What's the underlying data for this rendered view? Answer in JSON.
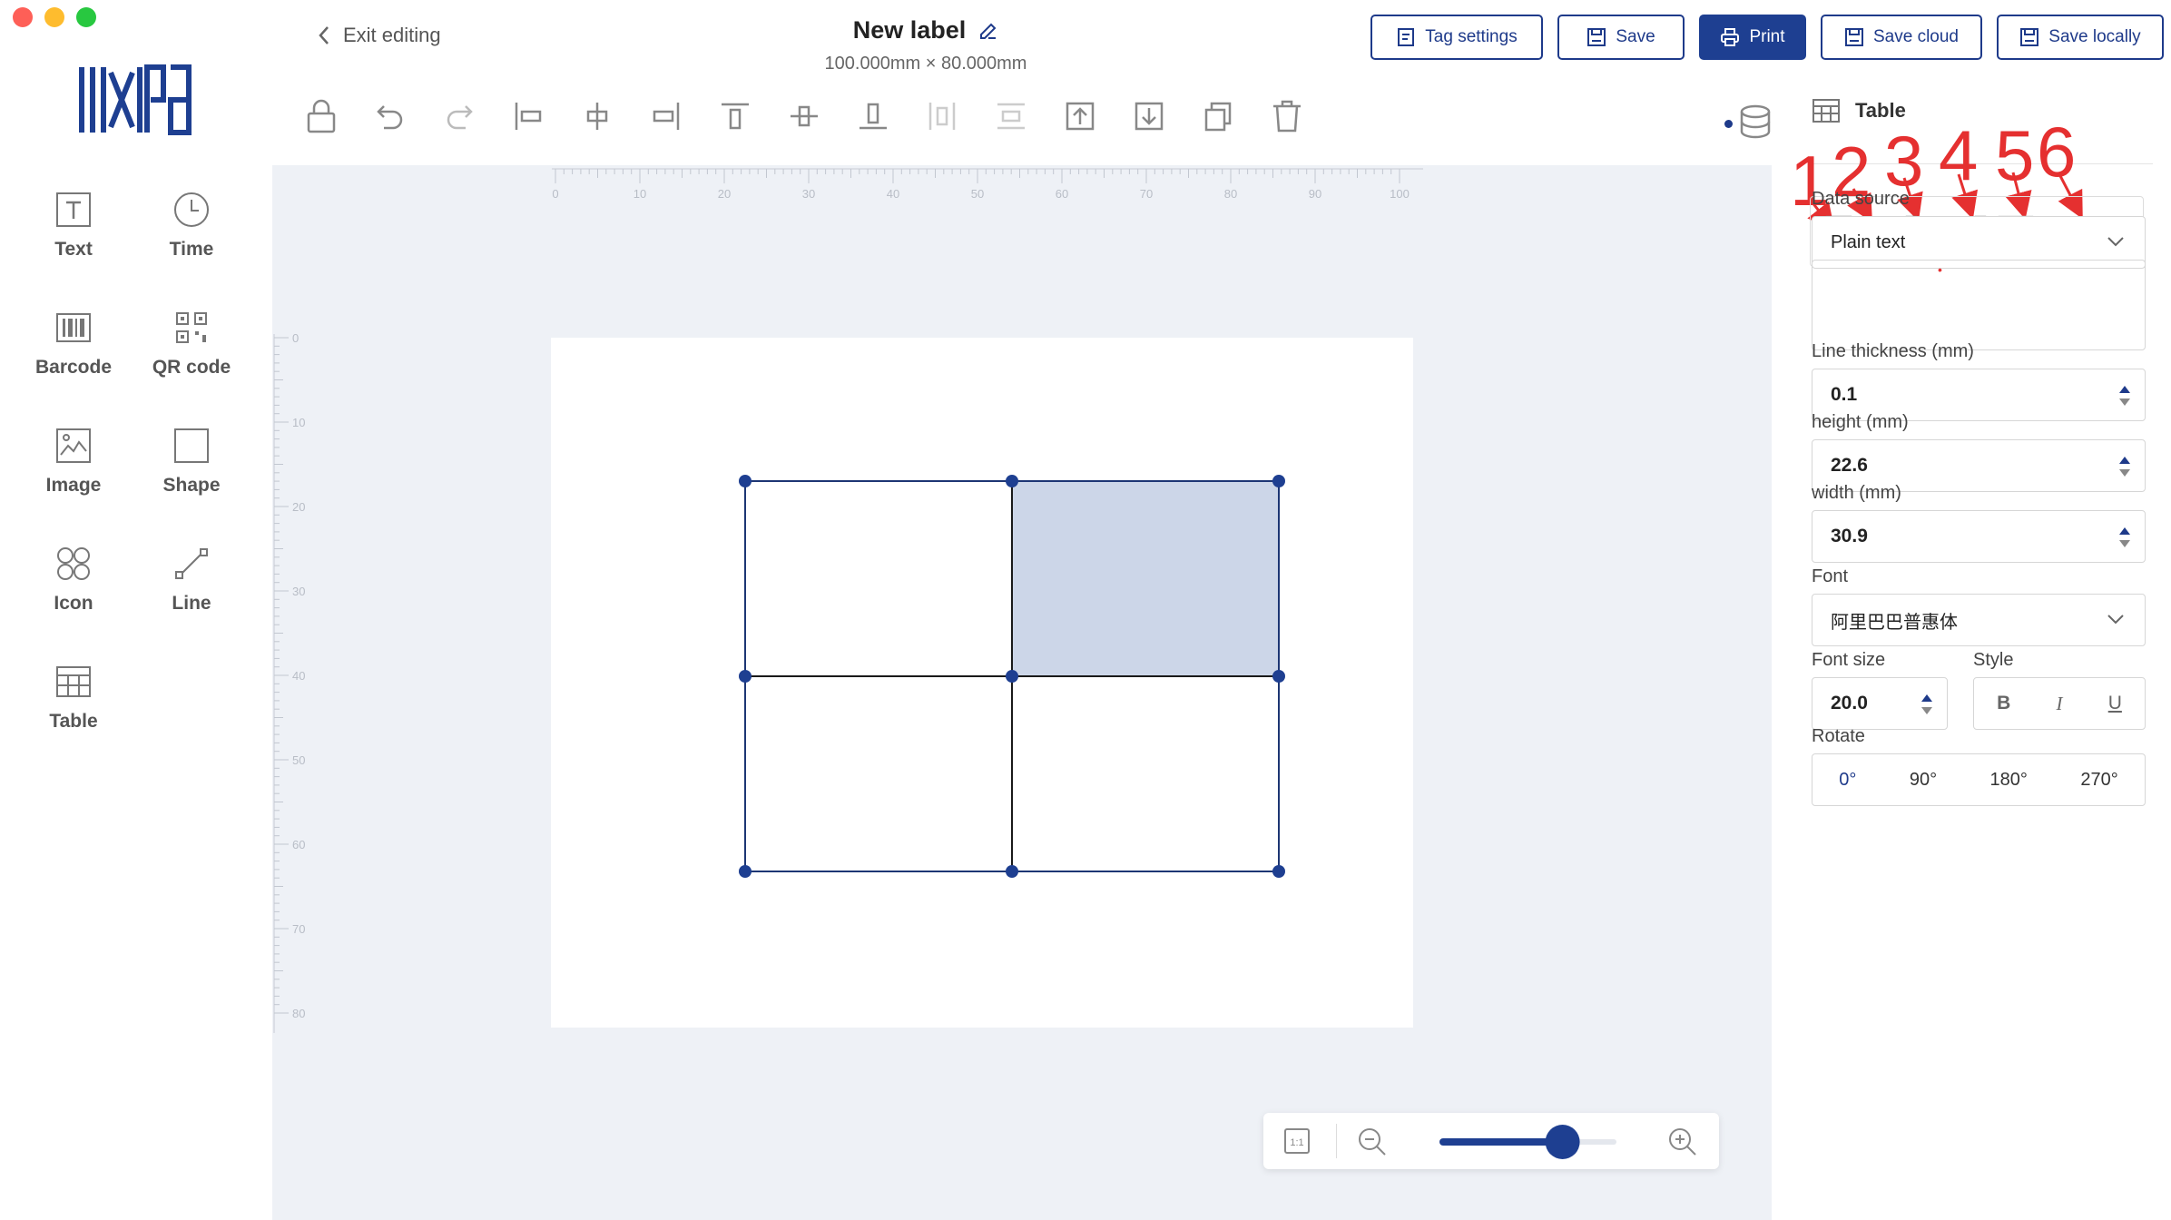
{
  "header": {
    "exit_label": "Exit editing",
    "title": "New label",
    "dimensions": "100.000mm × 80.000mm",
    "buttons": {
      "tag_settings": "Tag settings",
      "save": "Save",
      "print": "Print",
      "save_cloud": "Save cloud",
      "save_locally": "Save locally"
    }
  },
  "palette": {
    "items": [
      {
        "label": "Text",
        "icon": "text-icon"
      },
      {
        "label": "Time",
        "icon": "clock-icon"
      },
      {
        "label": "Barcode",
        "icon": "barcode-icon"
      },
      {
        "label": "QR code",
        "icon": "qr-code-icon"
      },
      {
        "label": "Image",
        "icon": "image-icon"
      },
      {
        "label": "Shape",
        "icon": "shape-icon"
      },
      {
        "label": "Icon",
        "icon": "icon-grid-icon"
      },
      {
        "label": "Line",
        "icon": "line-icon"
      },
      {
        "label": "Table",
        "icon": "table-icon"
      }
    ]
  },
  "toolbar": {
    "tools": [
      "lock-icon",
      "undo-icon",
      "redo-icon",
      "align-left-icon",
      "align-center-h-icon",
      "align-right-icon",
      "align-top-icon",
      "align-middle-v-icon",
      "align-bottom-icon",
      "distribute-h-icon",
      "distribute-v-icon",
      "bring-front-icon",
      "send-back-icon",
      "duplicate-icon",
      "delete-icon"
    ]
  },
  "rulers": {
    "horizontal_ticks": [
      "0",
      "10",
      "20",
      "30",
      "40",
      "50",
      "60",
      "70",
      "80",
      "90",
      "100"
    ],
    "vertical_ticks": [
      "0",
      "10",
      "20",
      "30",
      "40",
      "50",
      "60",
      "70",
      "80"
    ]
  },
  "table": {
    "rows": 2,
    "cols": 2,
    "selected_cell": {
      "row": 0,
      "col": 1
    }
  },
  "zoom": {
    "level": 0.7
  },
  "panel": {
    "title": "Table",
    "annotation_numbers": [
      "1",
      "2",
      "3",
      "4",
      "5",
      "6"
    ],
    "table_tools": [
      "merge-cells-icon",
      "insert-row-icon",
      "insert-column-icon",
      "delete-row-icon",
      "delete-column-icon",
      "split-cells-icon"
    ],
    "data_source_label": "Data source",
    "data_source_value": "Plain text",
    "line_thickness_label": "Line thickness (mm)",
    "line_thickness_value": "0.1",
    "height_label": "height (mm)",
    "height_value": "22.6",
    "width_label": "width (mm)",
    "width_value": "30.9",
    "font_label": "Font",
    "font_value": "阿里巴巴普惠体",
    "font_size_label": "Font size",
    "font_size_value": "20.0",
    "style_label": "Style",
    "style_options": [
      "B",
      "I",
      "U"
    ],
    "rotate_label": "Rotate",
    "rotate_options": [
      "0°",
      "90°",
      "180°",
      "270°"
    ]
  },
  "colors": {
    "accent": "#1e3f91",
    "annotation": "#e53030",
    "selected_cell": "#ccd6e8",
    "canvas_bg": "#eef1f6"
  }
}
